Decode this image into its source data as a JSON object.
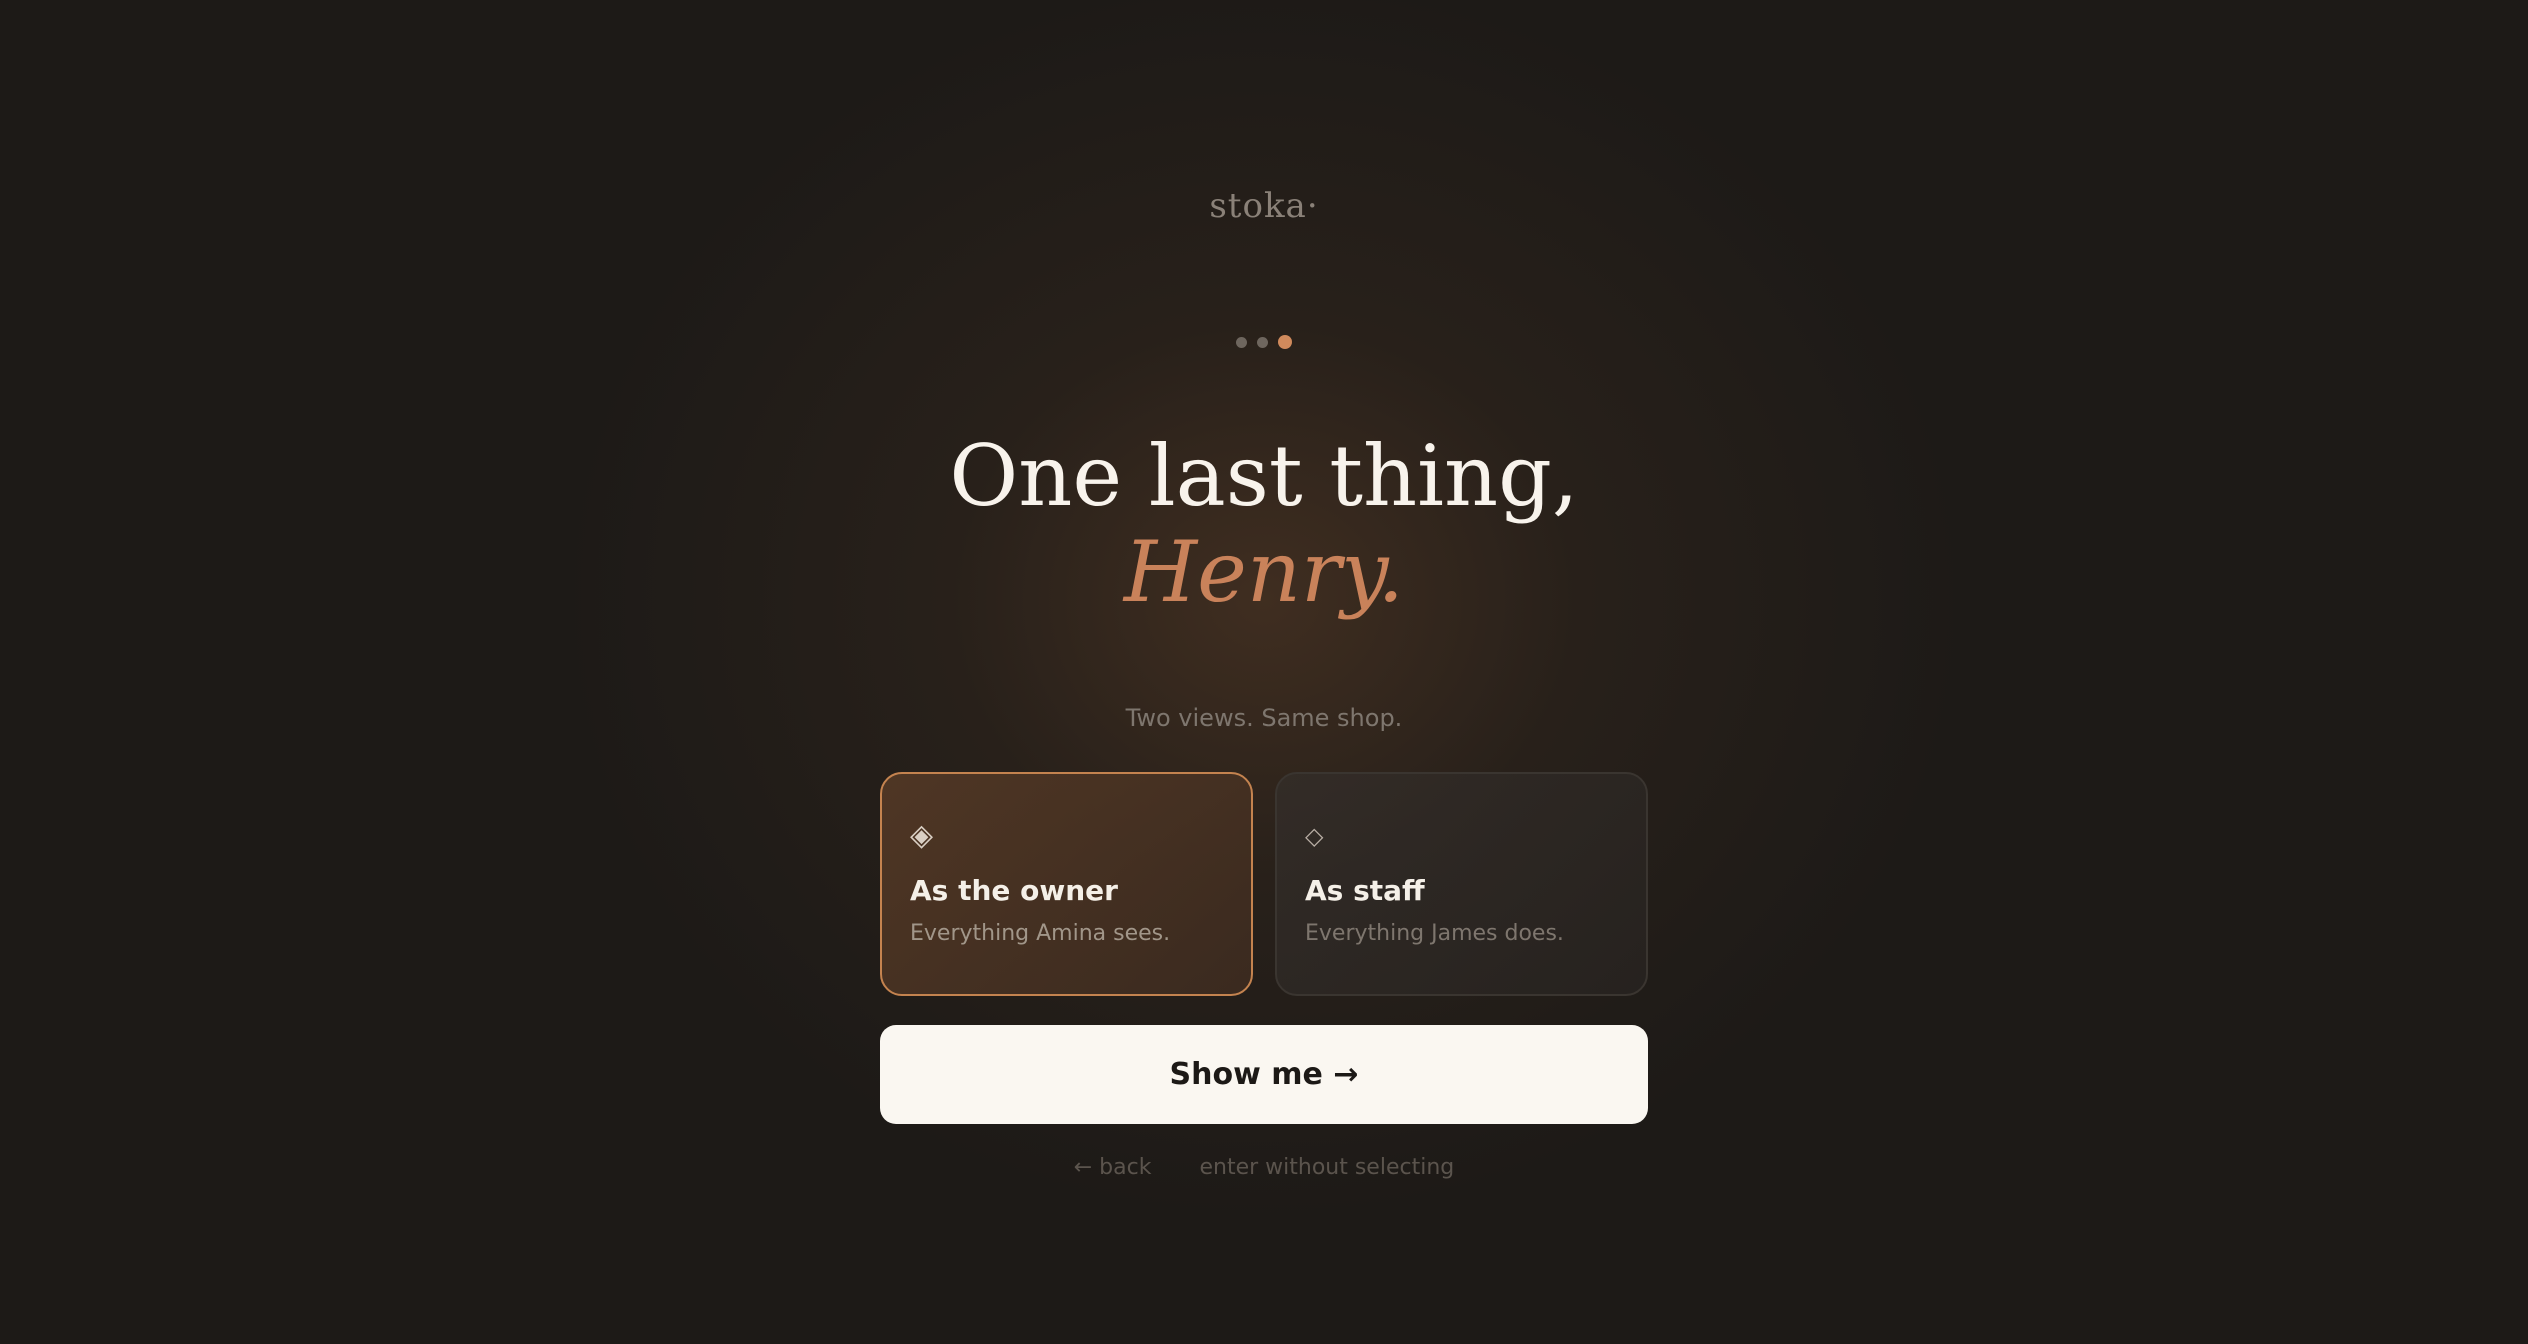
{
  "brand": {
    "logo": "stoka",
    "logo_dot": "·"
  },
  "steps": {
    "total": 3,
    "current": 3
  },
  "headline": {
    "line1": "One last thing,",
    "name": "Henry."
  },
  "subtitle": "Two views. Same shop.",
  "options": [
    {
      "icon": "◈",
      "icon_name": "diamond-filled-icon",
      "title": "As the owner",
      "description": "Everything Amina sees.",
      "selected": true
    },
    {
      "icon": "◇",
      "icon_name": "diamond-outline-icon",
      "title": "As staff",
      "description": "Everything James does.",
      "selected": false
    }
  ],
  "cta": {
    "label": "Show me →"
  },
  "links": {
    "back": "← back",
    "skip": "enter without selecting"
  },
  "colors": {
    "background": "#1d1a17",
    "accent": "#c9825a",
    "cta_background": "#faf7f1"
  }
}
